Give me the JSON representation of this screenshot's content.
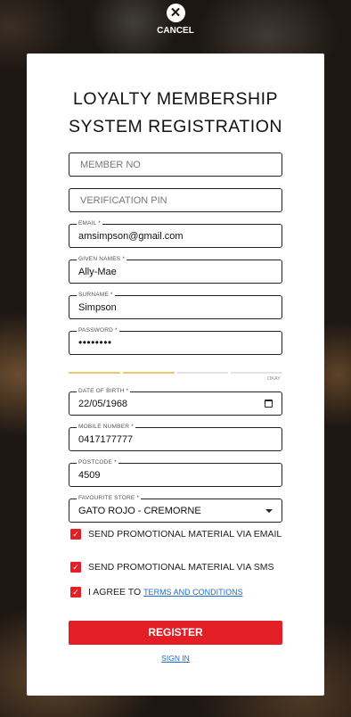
{
  "cancel": {
    "label": "CANCEL",
    "icon": "close-icon"
  },
  "form": {
    "title_line1": "LOYALTY MEMBERSHIP",
    "title_line2": "SYSTEM REGISTRATION",
    "member_no": {
      "placeholder": "MEMBER NO",
      "value": ""
    },
    "verification_pin": {
      "placeholder": "VERIFICATION PIN",
      "value": ""
    },
    "email": {
      "label": "EMAIL *",
      "value": "amsimpson@gmail.com"
    },
    "given_names": {
      "label": "GIVEN NAMES *",
      "value": "Ally-Mae"
    },
    "surname": {
      "label": "SURNAME *",
      "value": "Simpson"
    },
    "password": {
      "label": "PASSWORD *",
      "value": "••••••••"
    },
    "password_strength": {
      "label": "OKAY",
      "level": 0.5,
      "color": "#ecc96a"
    },
    "date_of_birth": {
      "label": "DATE OF BIRTH *",
      "value": "22/05/1968",
      "icon": "calendar-icon"
    },
    "mobile": {
      "label": "MOBILE NUMBER *",
      "value": "0417177777"
    },
    "postcode": {
      "label": "POSTCODE *",
      "value": "4509"
    },
    "store": {
      "label": "FAVOURITE STORE *",
      "value": "GATO ROJO - CREMORNE"
    },
    "promo_email": {
      "label": "SEND PROMOTIONAL MATERIAL VIA EMAIL",
      "checked": true
    },
    "promo_sms": {
      "label": "SEND PROMOTIONAL MATERIAL VIA SMS",
      "checked": true
    },
    "agree": {
      "prefix": "I AGREE TO",
      "link": "TERMS AND CONDITIONS",
      "checked": true
    },
    "register_label": "REGISTER",
    "signin_label": "SIGN IN"
  },
  "colors": {
    "accent": "#e41e25",
    "link": "#1a6fd1"
  }
}
